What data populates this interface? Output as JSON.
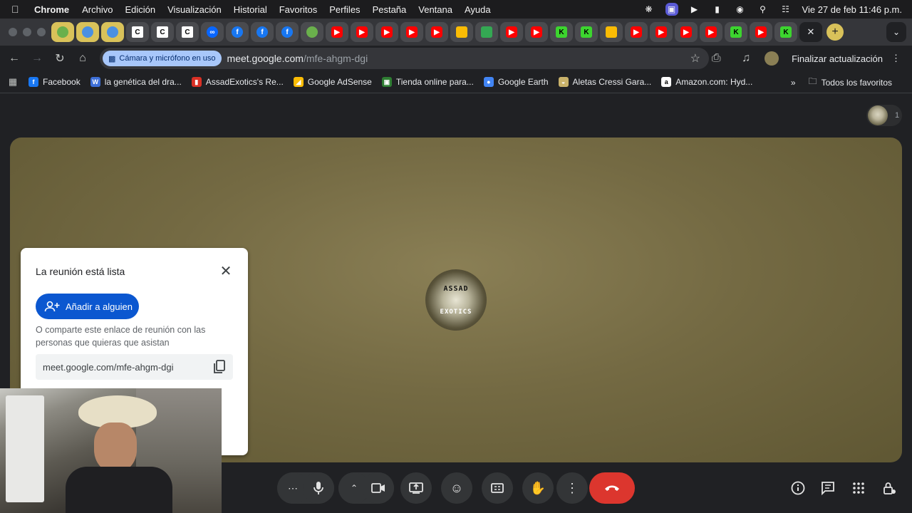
{
  "menubar": {
    "app_name": "Chrome",
    "items": [
      "Archivo",
      "Edición",
      "Visualización",
      "Historial",
      "Favoritos",
      "Perfiles",
      "Pestaña",
      "Ventana",
      "Ayuda"
    ],
    "clock": "Vie 27 de feb  11:46 p.m."
  },
  "tabs": {
    "icons": [
      "cc",
      "cc",
      "cc",
      "mt",
      "fb",
      "fb",
      "fb",
      "gr",
      "yt",
      "yt",
      "yt",
      "yt",
      "yt",
      "dr",
      "gm",
      "yt",
      "yt",
      "kk",
      "kk",
      "dr",
      "yt",
      "yt",
      "yt",
      "yt",
      "kk",
      "yt",
      "kk"
    ],
    "new_tab_label": "+"
  },
  "toolbar": {
    "camera_chip": "Cámara y micrófono en uso",
    "url_host": "meet.google.com",
    "url_path": "/mfe-ahgm-dgi",
    "update_label": "Finalizar actualización"
  },
  "bookmarks": {
    "items": [
      {
        "label": "Facebook",
        "color": "#1877f2",
        "glyph": "f"
      },
      {
        "label": "la genética del dra...",
        "color": "#3d6fd8",
        "glyph": "W"
      },
      {
        "label": "AssadExotics's Re...",
        "color": "#d93025",
        "glyph": "▮"
      },
      {
        "label": "Google AdSense",
        "color": "#fbbc04",
        "glyph": "◢"
      },
      {
        "label": "Tienda online para...",
        "color": "#2e7d32",
        "glyph": "▣"
      },
      {
        "label": "Google Earth",
        "color": "#4285f4",
        "glyph": "●"
      },
      {
        "label": "Aletas Cressi Gara...",
        "color": "#c9b26a",
        "glyph": "◒"
      },
      {
        "label": "Amazon.com: Hyd...",
        "color": "#ffffff",
        "glyph": "a"
      }
    ],
    "all_favorites": "Todos los favoritos"
  },
  "meet": {
    "participant_count": "1",
    "logo_top": "ASSAD",
    "logo_bottom": "EXOTICS",
    "dialog": {
      "title": "La reunión está lista",
      "add_button": "Añadir a alguien",
      "share_text": "O comparte este enlace de reunión con las personas que quieras que asistan",
      "meeting_link": "meet.google.com/mfe-ahgm-dgi"
    }
  },
  "colors": {
    "accent": "#0b57d0",
    "end_call": "#dc362e",
    "stage": "#746a43"
  }
}
